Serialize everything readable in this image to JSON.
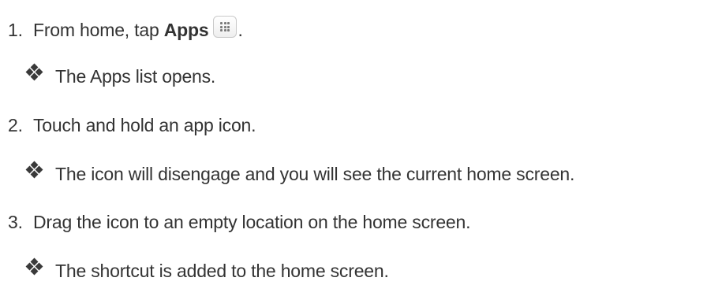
{
  "steps": [
    {
      "number": "1.",
      "text_before": "From home, tap ",
      "bold": "Apps",
      "text_after": ".",
      "icon": "apps-grid-icon",
      "result": "The Apps list opens."
    },
    {
      "number": "2.",
      "text": "Touch and hold an app icon.",
      "result": "The icon will disengage and you will see the current home screen."
    },
    {
      "number": "3.",
      "text": "Drag the icon to an empty location on the home screen.",
      "result": "The shortcut is added to the home screen."
    }
  ],
  "bullet_icon": "four-diamond-bullet-icon",
  "colors": {
    "text": "#333333",
    "bullet": "#3a3a3a"
  }
}
